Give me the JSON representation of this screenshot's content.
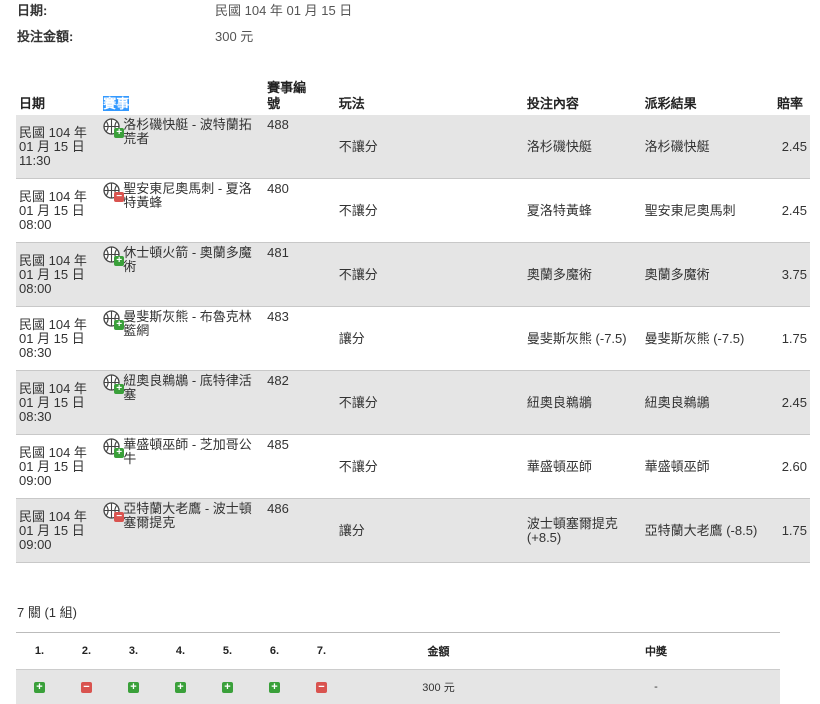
{
  "info": {
    "date_label": "日期:",
    "date_value": "民國 104 年 01 月 15 日",
    "amount_label": "投注金額:",
    "amount_value": "300 元"
  },
  "table": {
    "headers": {
      "date": "日期",
      "match": "賽事",
      "match_no": "賽事編號",
      "play": "玩法",
      "bet": "投注內容",
      "result": "派彩結果",
      "odds": "賠率"
    },
    "rows": [
      {
        "date": "民國 104 年 01 月 15 日 11:30",
        "status": "plus",
        "match": "洛杉磯快艇 - 波特蘭拓荒者",
        "no": "488",
        "play": "不讓分",
        "bet": "洛杉磯快艇",
        "result": "洛杉磯快艇",
        "odds": "2.45"
      },
      {
        "date": "民國 104 年 01 月 15 日 08:00",
        "status": "minus",
        "match": "聖安東尼奧馬刺 - 夏洛特黃蜂",
        "no": "480",
        "play": "不讓分",
        "bet": "夏洛特黃蜂",
        "result": "聖安東尼奧馬刺",
        "odds": "2.45"
      },
      {
        "date": "民國 104 年 01 月 15 日 08:00",
        "status": "plus",
        "match": "休士頓火箭 - 奧蘭多魔術",
        "no": "481",
        "play": "不讓分",
        "bet": "奧蘭多魔術",
        "result": "奧蘭多魔術",
        "odds": "3.75"
      },
      {
        "date": "民國 104 年 01 月 15 日 08:30",
        "status": "plus",
        "match": "曼斐斯灰熊 - 布魯克林籃網",
        "no": "483",
        "play": "讓分",
        "bet": "曼斐斯灰熊 (-7.5)",
        "result": "曼斐斯灰熊 (-7.5)",
        "odds": "1.75"
      },
      {
        "date": "民國 104 年 01 月 15 日 08:30",
        "status": "plus",
        "match": "紐奧良鵜鶘 - 底特律活塞",
        "no": "482",
        "play": "不讓分",
        "bet": "紐奧良鵜鶘",
        "result": "紐奧良鵜鶘",
        "odds": "2.45"
      },
      {
        "date": "民國 104 年 01 月 15 日 09:00",
        "status": "plus",
        "match": "華盛頓巫師 - 芝加哥公牛",
        "no": "485",
        "play": "不讓分",
        "bet": "華盛頓巫師",
        "result": "華盛頓巫師",
        "odds": "2.60"
      },
      {
        "date": "民國 104 年 01 月 15 日 09:00",
        "status": "minus",
        "match": "亞特蘭大老鷹 - 波士頓塞爾提克",
        "no": "486",
        "play": "讓分",
        "bet": "波士頓塞爾提克 (+8.5)",
        "result": "亞特蘭大老鷹 (-8.5)",
        "odds": "1.75"
      }
    ]
  },
  "summary": "7 關 (1 組)",
  "combo": {
    "headers": [
      "1.",
      "2.",
      "3.",
      "4.",
      "5.",
      "6.",
      "7."
    ],
    "amount_header": "金額",
    "prize_header": "中獎",
    "statuses": [
      "plus",
      "minus",
      "plus",
      "plus",
      "plus",
      "plus",
      "minus"
    ],
    "amount": "300 元",
    "prize": "-"
  },
  "colors": {
    "win": "#3aa03a",
    "loss": "#d9534f",
    "highlight": "#3399ff",
    "row_alt": "#e5e5e5"
  },
  "icons": {
    "plus": "+",
    "minus": "−"
  }
}
